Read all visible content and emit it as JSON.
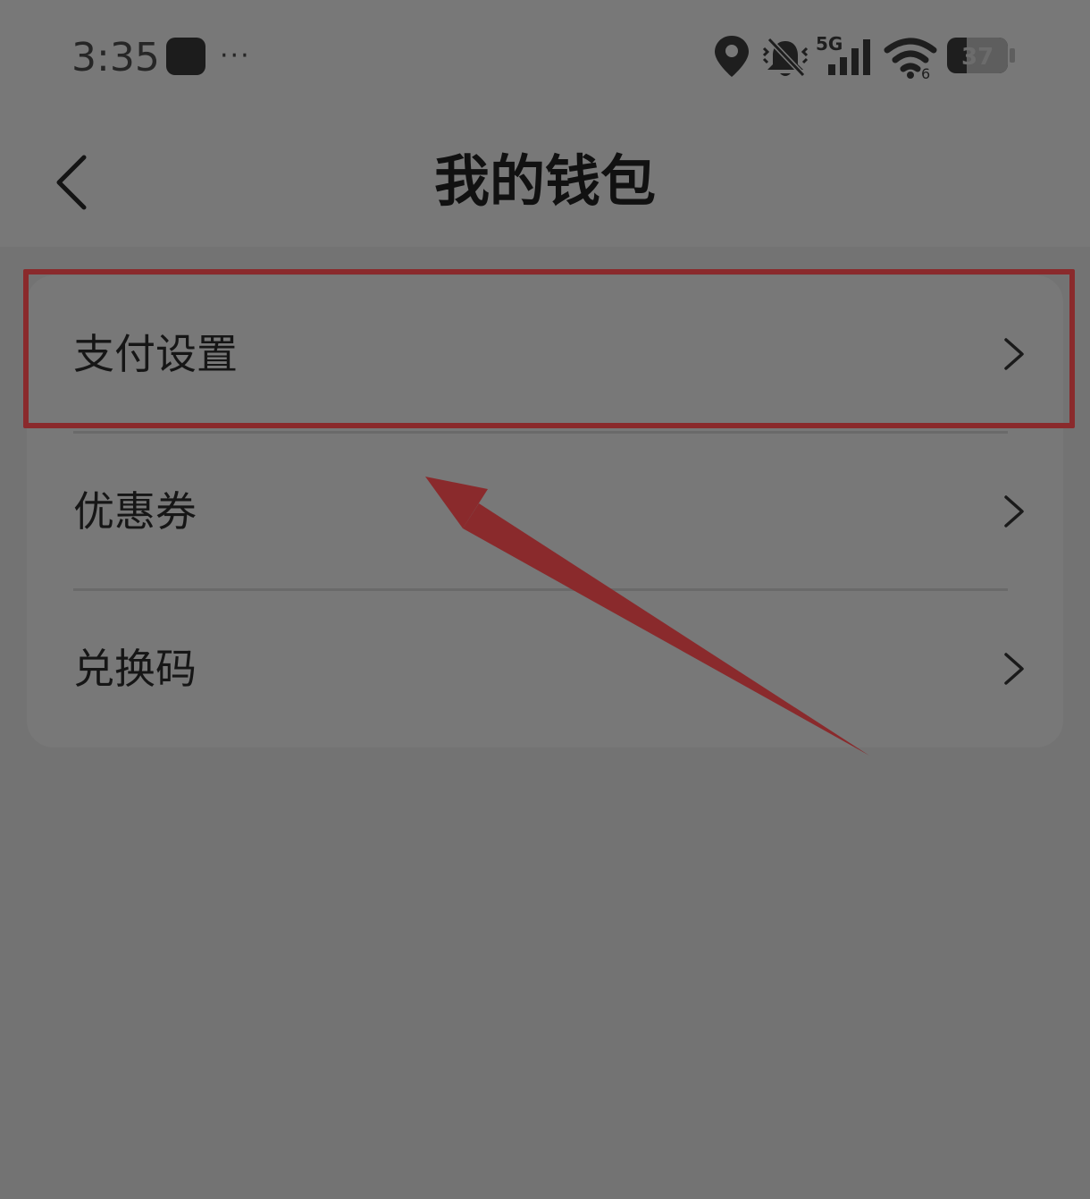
{
  "status_bar": {
    "time": "3:35",
    "more": "···",
    "network_label": "5G",
    "wifi_label": "6",
    "battery_level": "37",
    "icons": [
      "app-notification-icon",
      "location-icon",
      "silent-bell-icon",
      "signal-icon",
      "wifi-icon",
      "battery-icon"
    ]
  },
  "nav": {
    "title": "我的钱包",
    "back_icon": "chevron-left-icon"
  },
  "menu": {
    "items": [
      {
        "label": "支付设置",
        "icon": "chevron-right-icon"
      },
      {
        "label": "优惠券",
        "icon": "chevron-right-icon"
      },
      {
        "label": "兑换码",
        "icon": "chevron-right-icon"
      }
    ]
  },
  "annotation": {
    "color": "#8a2a2c",
    "target": "支付设置"
  },
  "colors": {
    "background": "#737373",
    "card": "#787878",
    "text": "#161616"
  }
}
